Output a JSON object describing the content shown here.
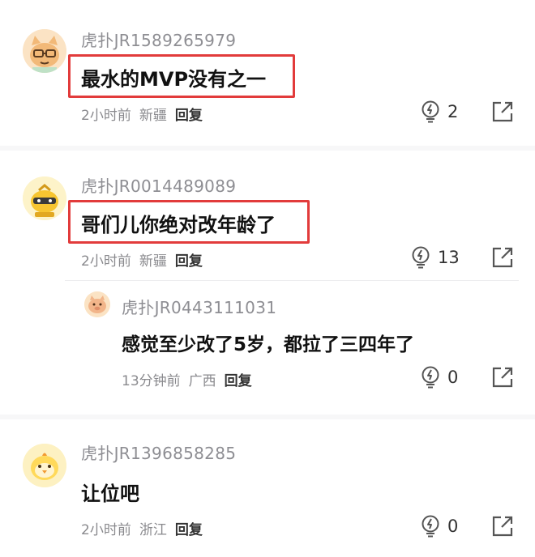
{
  "comments": [
    {
      "username": "虎扑JR1589265979",
      "content": "最水的MVP没有之一",
      "time": "2小时前",
      "location": "新疆",
      "reply_label": "回复",
      "likes": "2"
    },
    {
      "username": "虎扑JR0014489089",
      "content": "哥们儿你绝对改年龄了",
      "time": "2小时前",
      "location": "新疆",
      "reply_label": "回复",
      "likes": "13",
      "reply": {
        "username": "虎扑JR0443111031",
        "content": "感觉至少改了5岁，都拉了三四年了",
        "time": "13分钟前",
        "location": "广西",
        "reply_label": "回复",
        "likes": "0"
      }
    },
    {
      "username": "虎扑JR1396858285",
      "content": "让位吧",
      "time": "2小时前",
      "location": "浙江",
      "reply_label": "回复",
      "likes": "0"
    }
  ],
  "icons": {
    "like": "lightbulb-like-icon",
    "share": "share-icon"
  },
  "colors": {
    "highlight_border": "#e23b3b",
    "username": "#8e8e93",
    "meta": "#8a8a8e"
  }
}
